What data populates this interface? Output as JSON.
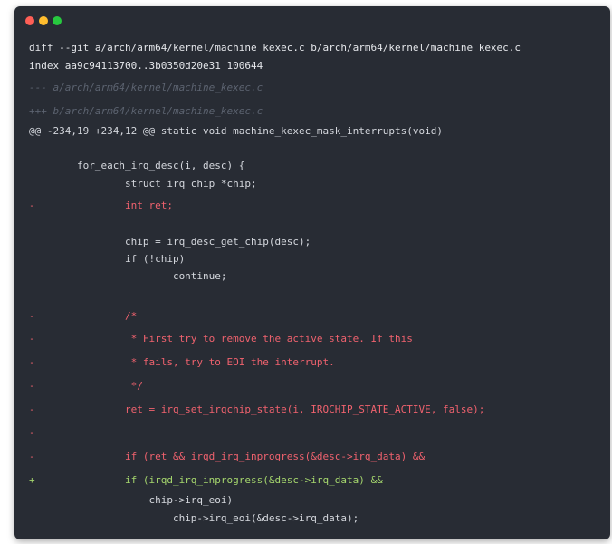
{
  "window": {
    "dots": [
      {
        "name": "close",
        "color": "#ff5f56"
      },
      {
        "name": "minimize",
        "color": "#ffbd2e"
      },
      {
        "name": "maximize",
        "color": "#27c93f"
      }
    ]
  },
  "diff": {
    "header_git": "diff --git a/arch/arm64/kernel/machine_kexec.c b/arch/arm64/kernel/machine_kexec.c",
    "header_index": "index aa9c94113700..3b0350d20e31 100644",
    "header_old": "--- a/arch/arm64/kernel/machine_kexec.c",
    "header_new": "+++ b/arch/arm64/kernel/machine_kexec.c",
    "hunk": "@@ -234,19 +234,12 @@ static void machine_kexec_mask_interrupts(void)",
    "lines": [
      {
        "sign": "",
        "type": "ctx",
        "text": "        for_each_irq_desc(i, desc) {"
      },
      {
        "sign": "",
        "type": "ctx",
        "text": "                struct irq_chip *chip;"
      },
      {
        "sign": "-",
        "type": "del",
        "text": "                int ret;"
      },
      {
        "sign": "",
        "type": "ctx",
        "text": "                chip = irq_desc_get_chip(desc);"
      },
      {
        "sign": "",
        "type": "ctx",
        "text": "                if (!chip)"
      },
      {
        "sign": "",
        "type": "ctx",
        "text": "                        continue;"
      },
      {
        "sign": "-",
        "type": "del",
        "text": "                /*"
      },
      {
        "sign": "-",
        "type": "del",
        "text": "                 * First try to remove the active state. If this"
      },
      {
        "sign": "-",
        "type": "del",
        "text": "                 * fails, try to EOI the interrupt."
      },
      {
        "sign": "-",
        "type": "del",
        "text": "                 */"
      },
      {
        "sign": "-",
        "type": "del",
        "text": "                ret = irq_set_irqchip_state(i, IRQCHIP_STATE_ACTIVE, false);"
      },
      {
        "sign": "-",
        "type": "del",
        "text": ""
      },
      {
        "sign": "-",
        "type": "del",
        "text": "                if (ret && irqd_irq_inprogress(&desc->irq_data) &&"
      },
      {
        "sign": "+",
        "type": "add",
        "text": "                if (irqd_irq_inprogress(&desc->irq_data) &&"
      },
      {
        "sign": "",
        "type": "ctx",
        "text": "                    chip->irq_eoi)"
      },
      {
        "sign": "",
        "type": "ctx",
        "text": "                        chip->irq_eoi(&desc->irq_data);"
      }
    ]
  }
}
